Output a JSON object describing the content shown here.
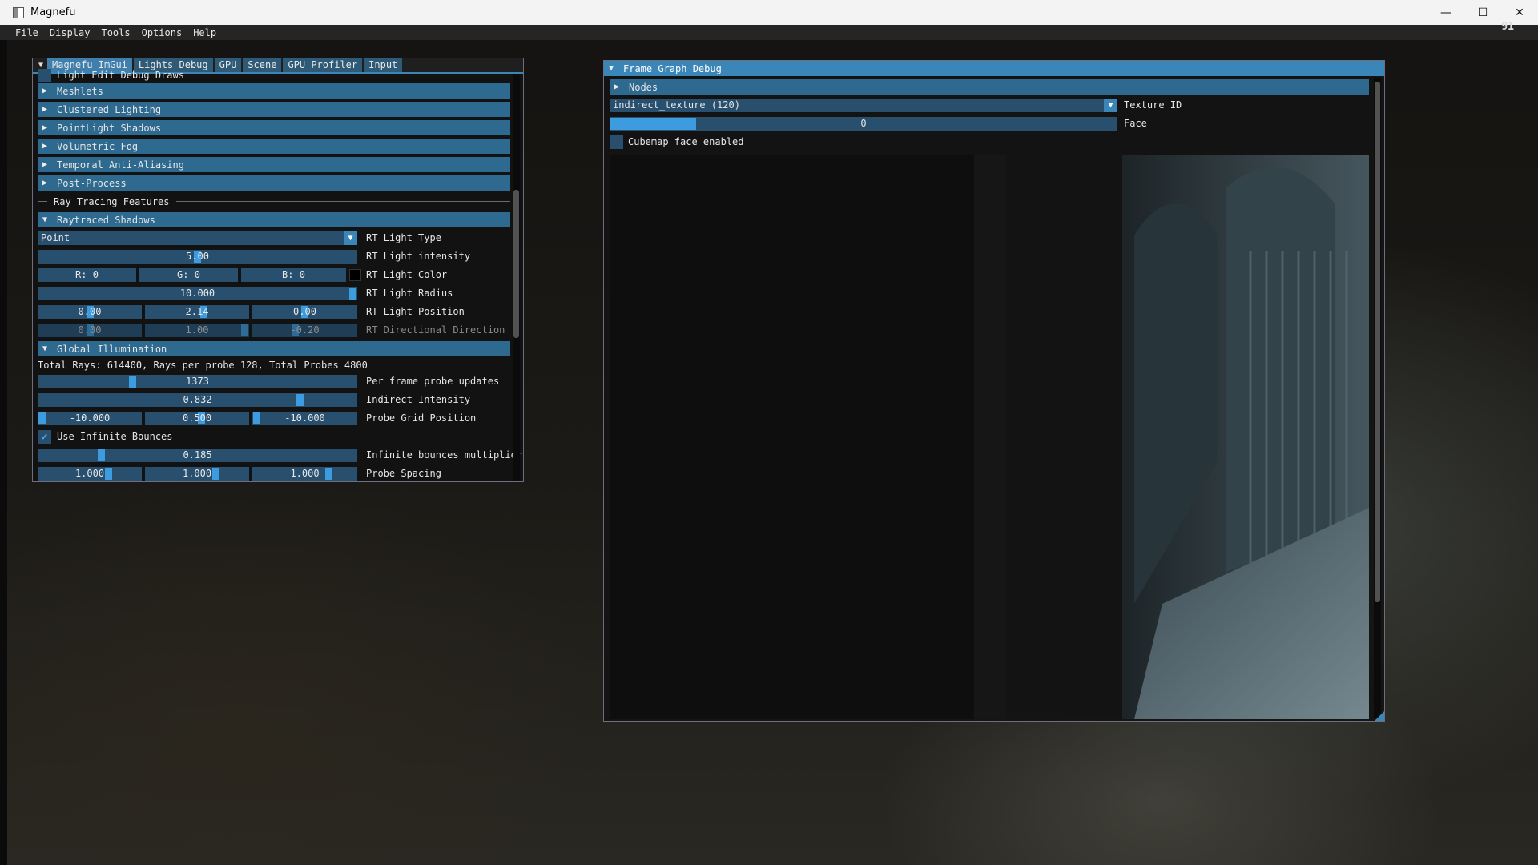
{
  "window": {
    "title": "Magnefu",
    "fps": "91"
  },
  "controls": {
    "minimize": "—",
    "maximize": "☐",
    "close": "✕"
  },
  "menu": [
    "File",
    "Display",
    "Tools",
    "Options",
    "Help"
  ],
  "settings": {
    "tabs": [
      "Magnefu ImGui",
      "Lights Debug",
      "GPU",
      "Scene",
      "GPU Profiler",
      "Input"
    ],
    "partial_item": "Light Edit Debug Draws",
    "sections": [
      "Meshlets",
      "Clustered Lighting",
      "PointLight Shadows",
      "Volumetric Fog",
      "Temporal Anti-Aliasing",
      "Post-Process"
    ],
    "rt_separator": "Ray Tracing Features",
    "rt_shadows": {
      "header": "Raytraced Shadows",
      "light_type": {
        "value": "Point",
        "label": "RT Light Type"
      },
      "intensity": {
        "value": "5.00",
        "label": "RT Light intensity",
        "fraction": 0.5
      },
      "color": {
        "r": "R:  0",
        "g": "G:  0",
        "b": "B:  0",
        "label": "RT Light Color",
        "swatch": "#000000"
      },
      "radius": {
        "value": "10.000",
        "label": "RT Light Radius",
        "fraction": 1.0
      },
      "position": {
        "values": [
          "0.00",
          "2.14",
          "0.00"
        ],
        "label": "RT Light Position",
        "fractions": [
          0.5,
          0.57,
          0.5
        ]
      },
      "direction": {
        "values": [
          "0.00",
          "1.00",
          "-0.20"
        ],
        "label": "RT Directional Direction",
        "fractions": [
          0.5,
          1.0,
          0.4
        ]
      }
    },
    "gi": {
      "header": "Global Illumination",
      "summary": "Total Rays: 614400, Rays per probe 128, Total Probes 4800",
      "probe_updates": {
        "value": "1373",
        "label": "Per frame probe updates",
        "fraction": 0.29
      },
      "indirect_intensity": {
        "value": "0.832",
        "label": "Indirect Intensity",
        "fraction": 0.83
      },
      "probe_grid": {
        "values": [
          "-10.000",
          "0.500",
          "-10.000"
        ],
        "label": "Probe Grid Position",
        "fractions": [
          0.0,
          0.55,
          0.0
        ]
      },
      "infinite_bounces": {
        "label": "Use Infinite Bounces",
        "checked": true
      },
      "bounce_mult": {
        "value": "0.185",
        "label": "Infinite bounces multiplier",
        "fraction": 0.19
      },
      "probe_spacing": {
        "values": [
          "1.000",
          "1.000",
          "1.000"
        ],
        "label": "Probe Spacing",
        "fractions": [
          0.7,
          0.7,
          0.75
        ]
      }
    }
  },
  "frame_graph": {
    "title": "Frame Graph Debug",
    "nodes": "Nodes",
    "texture": {
      "value": "indirect_texture (120)",
      "label": "Texture ID"
    },
    "face": {
      "value": "0",
      "label": "Face",
      "fraction": 0.17
    },
    "cubemap": {
      "label": "Cubemap face enabled",
      "checked": false
    }
  },
  "colors": {
    "accent": "#3b86b8",
    "header": "#2e6a8f",
    "frame": "#284f6d",
    "grab": "#3d9be0"
  }
}
